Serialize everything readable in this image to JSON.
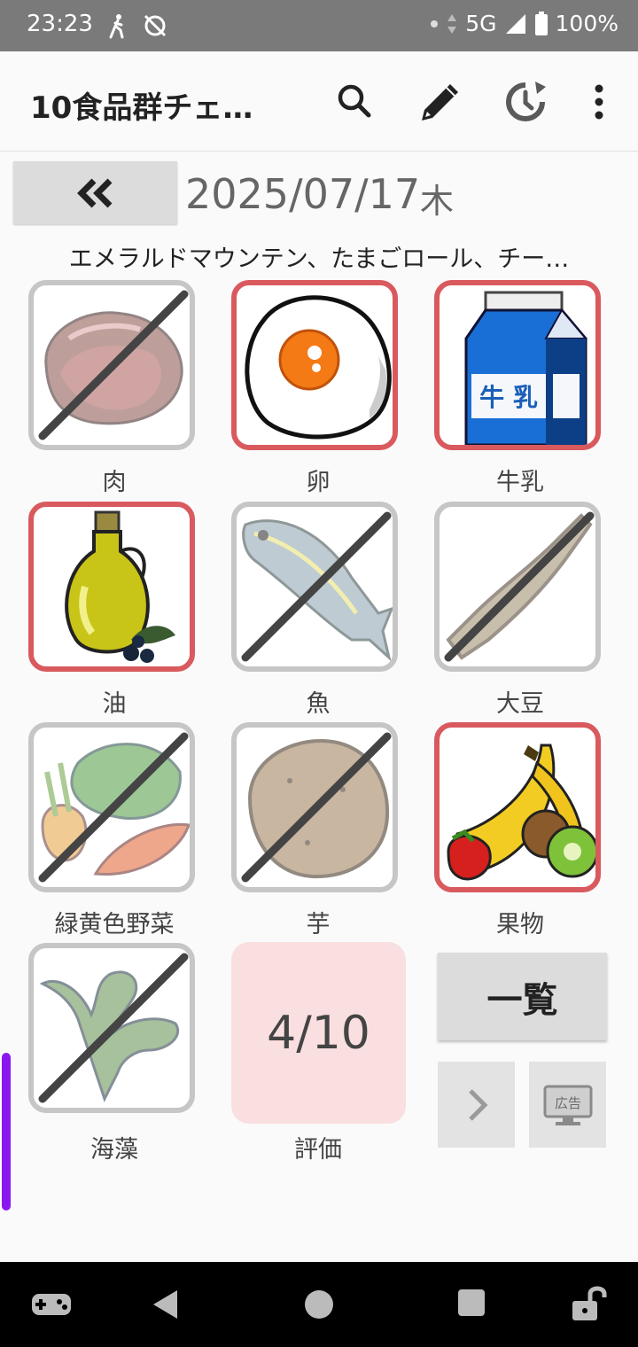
{
  "status_bar": {
    "time": "23:23",
    "network": "5G",
    "battery": "100%"
  },
  "app_bar": {
    "title": "10食品群チェ…"
  },
  "date_nav": {
    "date": "2025/07/17",
    "weekday": "木"
  },
  "menu_text": "エメラルドマウンテン、たまごロール、チー…",
  "food_groups": [
    {
      "label": "肉",
      "checked": false,
      "icon": "meat-icon"
    },
    {
      "label": "卵",
      "checked": true,
      "icon": "fried-egg-icon"
    },
    {
      "label": "牛乳",
      "checked": true,
      "icon": "milk-carton-icon",
      "carton_text": "牛 乳"
    },
    {
      "label": "油",
      "checked": true,
      "icon": "olive-oil-icon"
    },
    {
      "label": "魚",
      "checked": false,
      "icon": "fish-icon"
    },
    {
      "label": "大豆",
      "checked": false,
      "icon": "soybean-icon"
    },
    {
      "label": "緑黄色野菜",
      "checked": false,
      "icon": "vegetables-icon"
    },
    {
      "label": "芋",
      "checked": false,
      "icon": "potato-icon"
    },
    {
      "label": "果物",
      "checked": true,
      "icon": "fruits-icon"
    },
    {
      "label": "海藻",
      "checked": false,
      "icon": "seaweed-icon"
    }
  ],
  "score": {
    "value": "4/10",
    "label": "評価"
  },
  "list_button": {
    "label": "一覧"
  },
  "ad_icon_text": "広告",
  "colors": {
    "checked_border": "#d95a5e",
    "unchecked_border": "#c6c6c6",
    "score_bg": "#fadfe0",
    "scroll_indicator": "#8a17f0"
  }
}
